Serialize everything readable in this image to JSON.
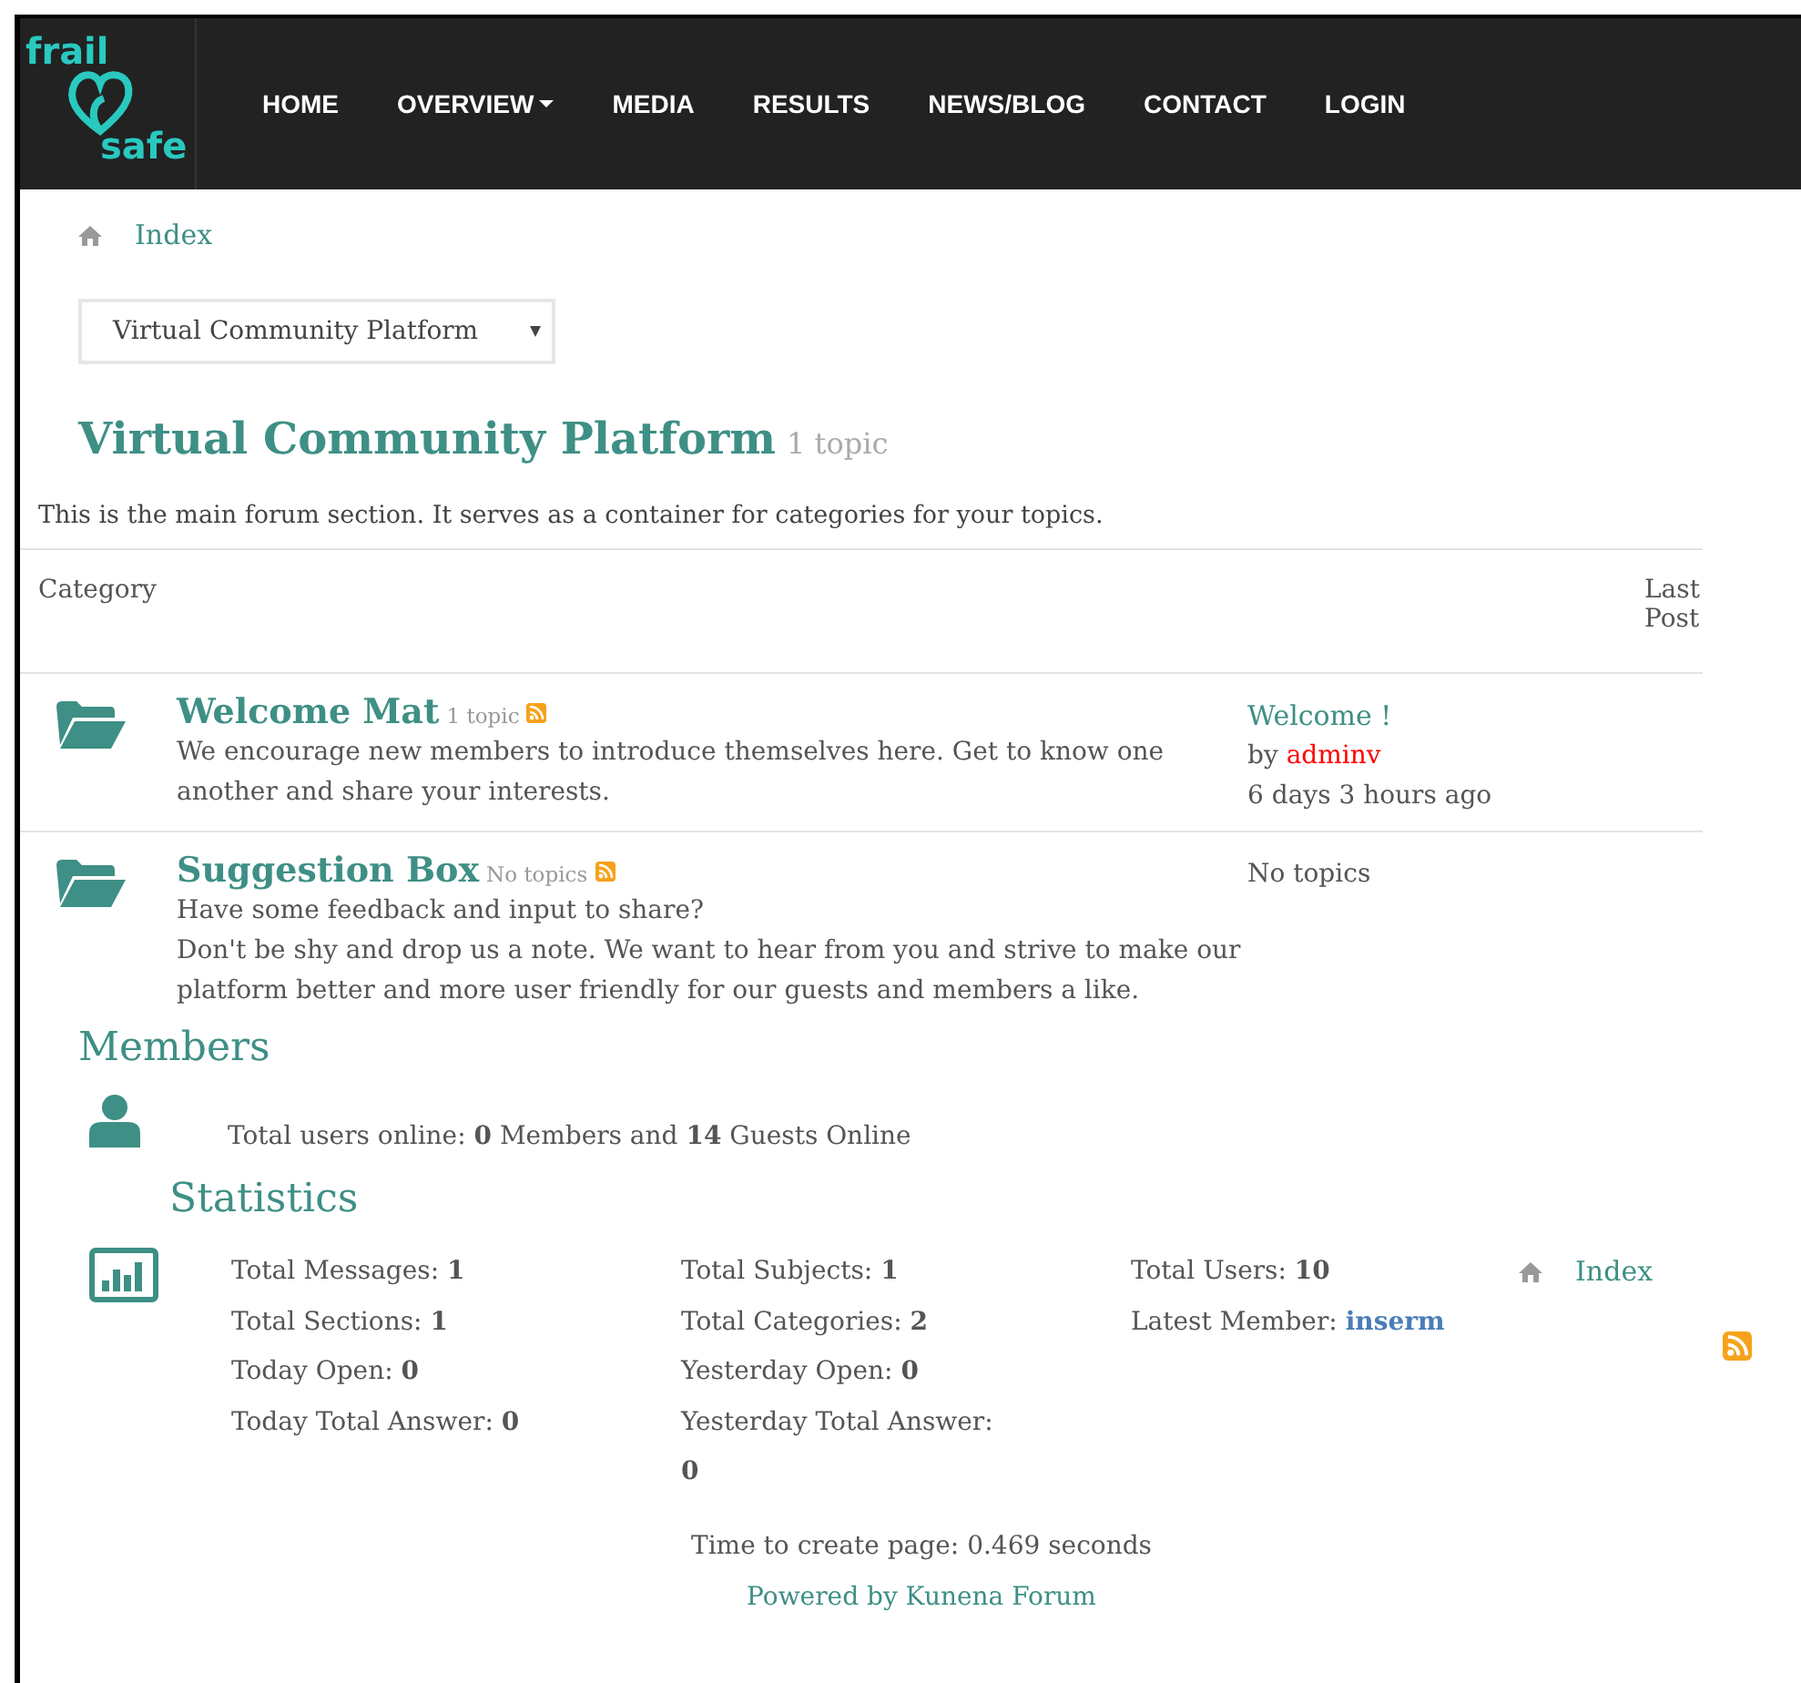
{
  "nav": {
    "logo_top": "frail",
    "logo_bottom": "safe",
    "items": [
      {
        "label": "HOME",
        "dropdown": false
      },
      {
        "label": "OVERVIEW",
        "dropdown": true
      },
      {
        "label": "MEDIA",
        "dropdown": false
      },
      {
        "label": "RESULTS",
        "dropdown": false
      },
      {
        "label": "NEWS/BLOG",
        "dropdown": false
      },
      {
        "label": "CONTACT",
        "dropdown": false
      },
      {
        "label": "LOGIN",
        "dropdown": false
      }
    ]
  },
  "breadcrumb": "Index",
  "category_select": {
    "value": "Virtual Community Platform"
  },
  "heading": {
    "title": "Virtual Community Platform",
    "count": "1 topic"
  },
  "description": "This is the main forum section. It serves as a container for categories for your topics.",
  "table": {
    "columns": [
      "Category",
      "Last Post"
    ],
    "rows": [
      {
        "title": "Welcome Mat",
        "count": "1 topic",
        "description": [
          "We encourage new members to introduce themselves here. Get to know one another and share your interests."
        ],
        "last_post": {
          "kind": "post",
          "title": "Welcome !",
          "by": "by",
          "author": "adminv",
          "time": "6 days 3 hours ago"
        }
      },
      {
        "title": "Suggestion Box",
        "count": "No topics",
        "description": [
          "Have some feedback and input to share?",
          "Don't be shy and drop us a note. We want to hear from you and strive to make our platform better and more user friendly for our guests and members a like."
        ],
        "last_post": {
          "kind": "empty",
          "text": "No topics"
        }
      }
    ]
  },
  "members": {
    "title": "Members",
    "online": "Total users online: **0** Members and **14** Guests Online"
  },
  "statistics": {
    "title": "Statistics",
    "columns": [
      [
        "Total Messages: **1**",
        "Total Sections: **1**",
        "Today Open: **0**",
        "Today Total Answer: **0**"
      ],
      [
        "Total Subjects: **1**",
        "Total Categories: **2**",
        "Yesterday Open: **0**",
        "Yesterday Total Answer: **0**"
      ]
    ],
    "total_users": "Total Users: **10**",
    "latest_label": "Latest Member:",
    "latest_member": "inserm",
    "index_link": "Index"
  },
  "footer": {
    "time": "Time to create page: 0.469 seconds",
    "powered": "Powered by Kunena Forum"
  }
}
